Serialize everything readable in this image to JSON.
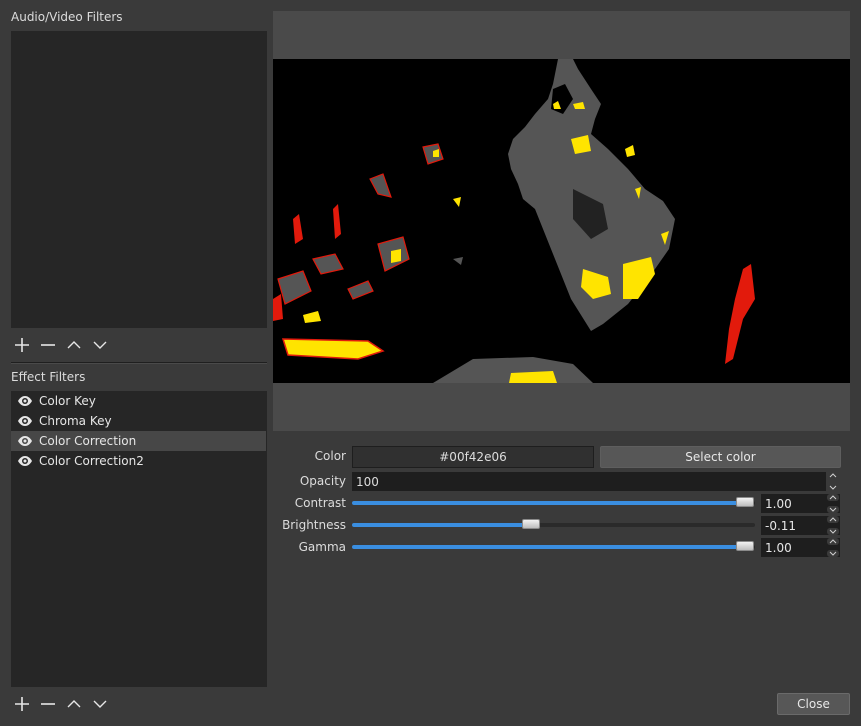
{
  "audio_video": {
    "title": "Audio/Video Filters"
  },
  "effects": {
    "title": "Effect Filters",
    "items": [
      {
        "label": "Color Key",
        "icon": "eye-icon"
      },
      {
        "label": "Chroma Key",
        "icon": "eye-icon"
      },
      {
        "label": "Color Correction",
        "icon": "eye-icon",
        "selected": true
      },
      {
        "label": "Color Correction2",
        "icon": "eye-icon"
      }
    ]
  },
  "toolbar_icons": [
    "plus-icon",
    "minus-icon",
    "chevron-up-icon",
    "chevron-down-icon"
  ],
  "properties": {
    "color": {
      "label": "Color",
      "value": "#00f42e06",
      "button": "Select color"
    },
    "opacity": {
      "label": "Opacity",
      "value": "100"
    },
    "contrast": {
      "label": "Contrast",
      "value": "1.00",
      "level": 0.975
    },
    "brightness": {
      "label": "Brightness",
      "value": "-0.11",
      "level": 0.445
    },
    "gamma": {
      "label": "Gamma",
      "value": "1.00",
      "level": 0.975
    }
  },
  "footer": {
    "close_label": "Close"
  },
  "colors": {
    "accent": "#3a8ee0",
    "panel": "#262626",
    "window": "#3a3a3a",
    "preview_bg": "#000000",
    "preview_gray": "#555555",
    "preview_yellow": "#ffe400",
    "preview_red": "#e21a0c"
  }
}
